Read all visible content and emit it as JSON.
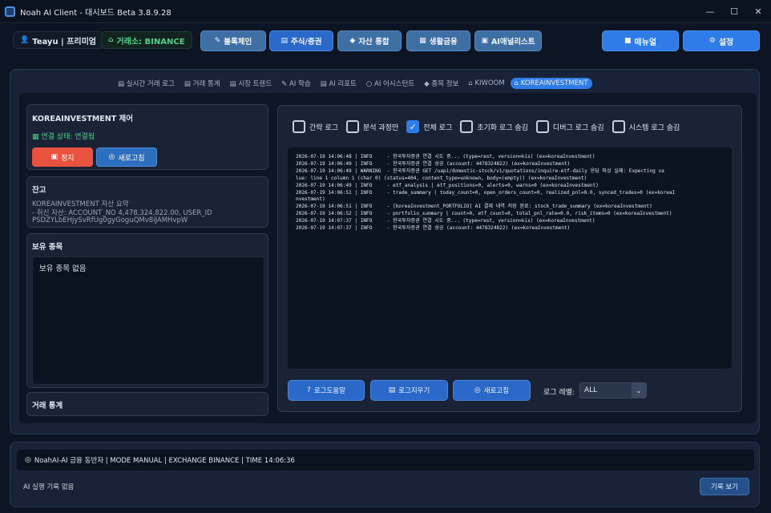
{
  "window": {
    "title": "Noah AI Client - 대시보드 Beta 3.8.9.28",
    "minimize": "—",
    "maximize": "☐",
    "close": "✕"
  },
  "topbar": {
    "user": "Teayu | 프리미엄",
    "user_icon": "👤",
    "exchange": "거래소: BINANCE",
    "exchange_icon": "⌂",
    "nav": [
      {
        "label": "블록체인",
        "icon": "✎"
      },
      {
        "label": "주식/증권",
        "icon": "▤"
      },
      {
        "label": "자산 통합",
        "icon": "◆"
      },
      {
        "label": "생활금융",
        "icon": "▦"
      },
      {
        "label": "AI애널리스트",
        "icon": "▣"
      }
    ],
    "manual": "매뉴얼",
    "manual_icon": "■",
    "settings": "설정",
    "settings_icon": "⚙"
  },
  "subtabs": [
    {
      "label": "실시간 거래 로그",
      "icon": "▤"
    },
    {
      "label": "거래 통계",
      "icon": "▤"
    },
    {
      "label": "시장 트렌드",
      "icon": "▤"
    },
    {
      "label": "AI 학습",
      "icon": "✎"
    },
    {
      "label": "AI 리포트",
      "icon": "▤"
    },
    {
      "label": "AI 어시스턴트",
      "icon": "○"
    },
    {
      "label": "종목 정보",
      "icon": "◆"
    },
    {
      "label": "KIWOOM",
      "icon": "⌂"
    },
    {
      "label": "KOREAINVESTMENT",
      "icon": "⌂"
    }
  ],
  "control": {
    "title": "KOREAINVESTMENT 제어",
    "status": "연결 상태: 연결됨",
    "status_icon": "▦",
    "stop": "정지",
    "stop_icon": "▣",
    "refresh": "새로고침",
    "refresh_icon": "◎"
  },
  "balance": {
    "title": "잔고",
    "lines": [
      "KOREAINVESTMENT 자산 요약",
      "- 취신 자산: ACCOUNT_NO 4,478,324,822.00, USER_ID",
      "PSDZYLbEHjySvRfUg0gyGoguQMv8iJAMHvpW"
    ]
  },
  "holdings": {
    "title": "보유 종목",
    "empty": "보유 종목 없음"
  },
  "trade_stats": {
    "title": "거래 통계"
  },
  "log": {
    "checkboxes": [
      {
        "label": "간략 로그",
        "checked": false
      },
      {
        "label": "분석 과정만",
        "checked": false
      },
      {
        "label": "전체 로그",
        "checked": true
      },
      {
        "label": "초기화 로그 숨김",
        "checked": false
      },
      {
        "label": "디버그 로그 숨김",
        "checked": false
      },
      {
        "label": "시스템 로그 숨김",
        "checked": false
      }
    ],
    "check_mark": "✓",
    "lines": [
      "2026-07-19 14:06:48 | INFO     - 한국투자증권 연결 시도 중... (type=rest, version=kis) (ex=koreaInvestment)",
      "2026-07-19 14:06:49 | INFO     - 한국투자증권 연결 성공 (account: 4478324822) (ex=koreaInvestment)",
      "2026-07-19 14:06:49 | WARNING  - 한국투자증권 GET /uapi/domestic-stock/v1/quotations/inquire-etf-daily 응답 파싱 실패: Expecting va",
      "lue: line 1 column 1 (char 0) (status=404, content_type=unknown, body=(empty)) (ex=koreaInvestment)",
      "2026-07-19 14:06:49 | INFO     - etf_analysis | etf_positions=0, alerts=0, warns=0 (ex=koreaInvestment)",
      "2026-07-19 14:06:51 | INFO     - trade_summary | today_count=0, open_orders_count=0, realized_pnl=0.0, synced_trades=0 (ex=koreaI",
      "nvestment)",
      "2026-07-19 14:06:51 | INFO     - [koreaInvestment_PORTFOLIO] AI 결제 내역 저장 완료: stock_trade_summary (ex=koreaInvestment)",
      "2026-07-19 14:06:52 | INFO     - portfolio_summary | count=0, etf_count=0, total_pnl_rate=0.0, risk_items=0 (ex=koreaInvestment)",
      "2026-07-19 14:07:37 | INFO     - 한국투자증권 연결 시도 중... (type=rest, version=kis) (ex=koreaInvestment)",
      "2026-07-19 14:07:37 | INFO     - 한국투자증권 연결 성공 (account: 4478324822) (ex=koreaInvestment)"
    ],
    "buttons": [
      {
        "label": "로그도움말",
        "icon": "?"
      },
      {
        "label": "로그지우기",
        "icon": "▤"
      },
      {
        "label": "새로고침",
        "icon": "◎"
      }
    ],
    "level_label": "로그 레벨:",
    "level_value": "ALL",
    "level_arrow": "⌄"
  },
  "status": {
    "icon": "◎",
    "text": "NoahAI-AI 금융 동반자 | MODE MANUAL | EXCHANGE BINANCE | TIME 14:06:36",
    "ai_history": "AI 실행 기록 없음",
    "history_btn": "기록 보기"
  },
  "colors": {
    "background": "#0d1524",
    "accent": "#2f7be8",
    "danger": "#e8523f",
    "success": "#4fd18b"
  }
}
